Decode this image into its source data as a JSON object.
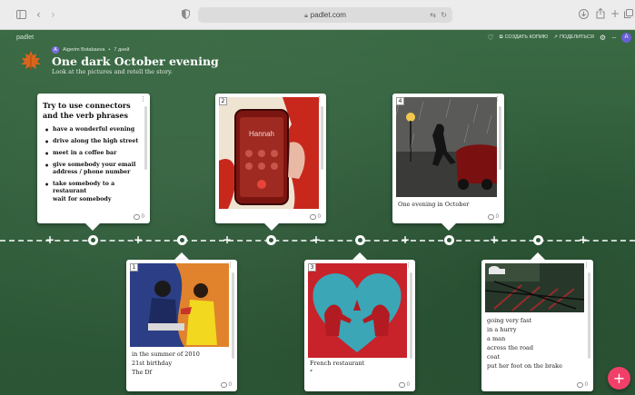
{
  "browser": {
    "url": "padlet.com",
    "icons": [
      "sidebar-icon",
      "back-icon",
      "forward-icon",
      "shield-icon",
      "lock-icon",
      "translate-icon",
      "reload-icon",
      "download-icon",
      "share-icon",
      "new-tab-icon",
      "tabs-icon"
    ]
  },
  "padlet": {
    "brand": "padlet",
    "author": "Aigerim Botabaeva",
    "author_initial": "A",
    "time_ago": "7 дней",
    "separator": "•",
    "title": "One dark October evening",
    "subtitle": "Look at the pictures and retell the story.",
    "toolbar": {
      "copy_label": "СОЗДАТЬ КОПИЮ",
      "share_label": "ПОДЕЛИТЬСЯ",
      "user_initial": "A"
    }
  },
  "posts": {
    "note": {
      "title": "Try to use connectors and the verb phrases",
      "items": [
        "have a wonderful evening",
        "drive along the high street",
        "meet in a coffee bar",
        "give somebody your email address / phone number",
        "take somebody to a restaurant"
      ],
      "extra": "wait for somebody",
      "comments": "0"
    },
    "post2": {
      "number": "2",
      "phone_caller": "Hannah",
      "comments": "0"
    },
    "post4": {
      "number": "4",
      "caption": "One evening in October",
      "comments": "0"
    },
    "post1": {
      "number": "1",
      "lines": [
        "in the summer of 2010",
        "21st birthday",
        "The Df"
      ],
      "comments": "0"
    },
    "post3": {
      "number": "3",
      "lines": [
        "French restaurant",
        "f..."
      ],
      "comments": "0"
    },
    "post5": {
      "lines": [
        "going very fast",
        "in a hurry",
        "a man",
        "across the road",
        "coat",
        "put her foot on the brake"
      ],
      "comments": "0"
    }
  },
  "fab_label": "+",
  "colors": {
    "board_green": "#2f5c3a",
    "fab_pink": "#f0406a",
    "card_white": "#ffffff"
  }
}
